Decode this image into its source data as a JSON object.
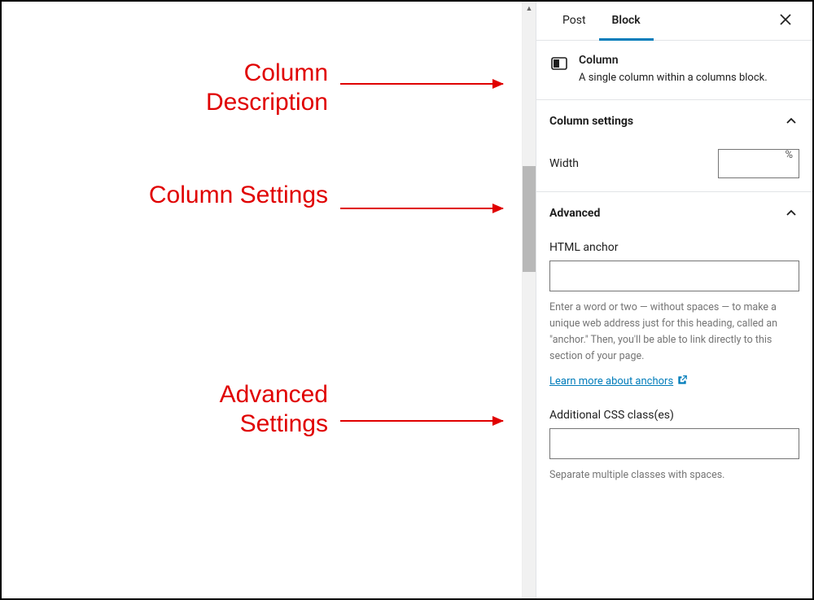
{
  "tabs": {
    "post": "Post",
    "block": "Block"
  },
  "block": {
    "title": "Column",
    "description": "A single column within a columns block."
  },
  "panels": {
    "settings_title": "Column settings",
    "width_label": "Width",
    "width_unit": "%",
    "advanced_title": "Advanced",
    "anchor_label": "HTML anchor",
    "anchor_help": "Enter a word or two — without spaces — to make a unique web address just for this heading, called an \"anchor.\" Then, you'll be able to link directly to this section of your page.",
    "anchor_link_text": "Learn more about anchors",
    "css_label": "Additional CSS class(es)",
    "css_help": "Separate multiple classes with spaces."
  },
  "annotations": {
    "desc": "Column Description",
    "settings": "Column Settings",
    "advanced": "Advanced Settings"
  }
}
